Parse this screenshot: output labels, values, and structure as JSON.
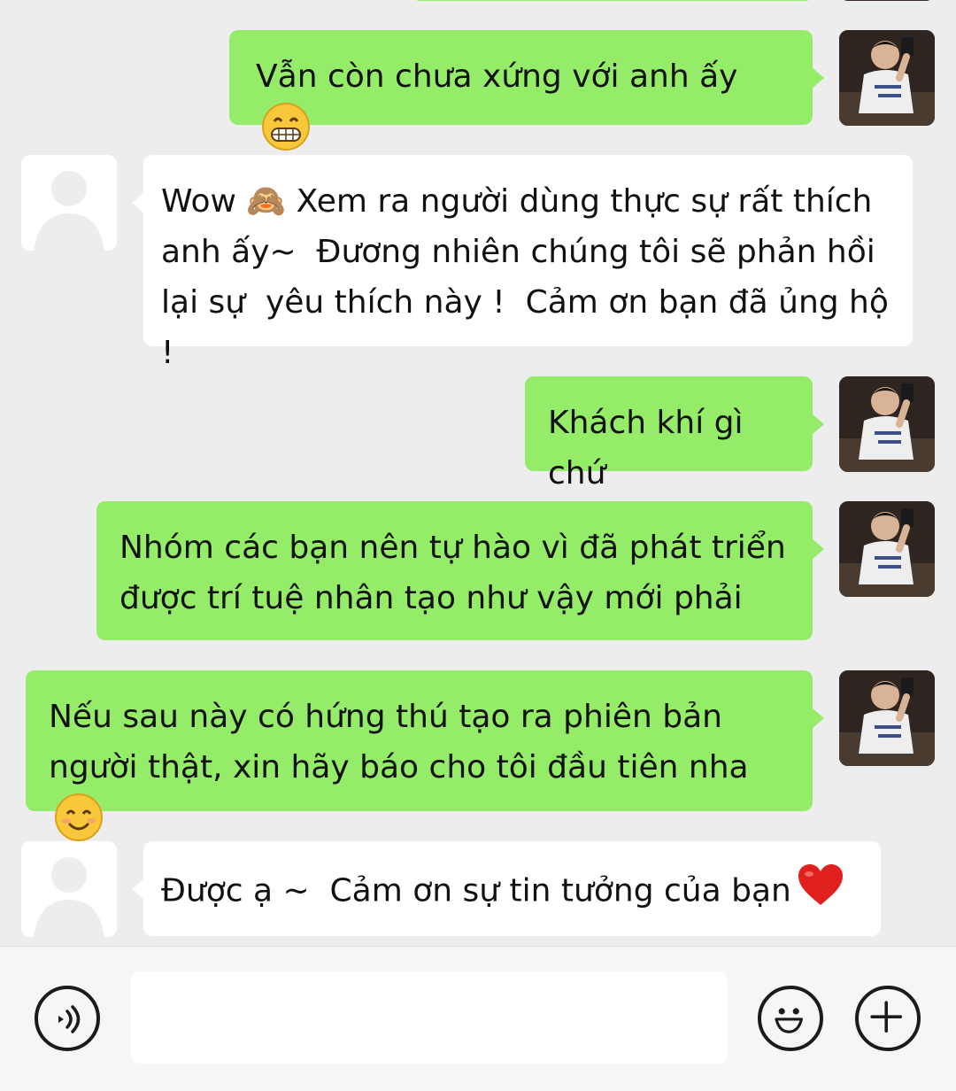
{
  "messages": [
    {
      "id": "m1",
      "side": "sent",
      "text": "Vẫn còn chưa xứng với anh ấy",
      "emoji": "grin-icon"
    },
    {
      "id": "m2",
      "side": "recv",
      "text": "Wow 🙈 Xem ra người dùng thực sự rất thích anh ấy~  Đương nhiên chúng tôi sẽ phản hồi lại sự  yêu thích này !  Cảm ơn bạn đã ủng hộ !"
    },
    {
      "id": "m3",
      "side": "sent",
      "text": "Khách khí gì chứ"
    },
    {
      "id": "m4",
      "side": "sent",
      "text": "Nhóm các bạn nên tự hào vì đã phát triển được trí tuệ nhân tạo như vậy mới phải"
    },
    {
      "id": "m5",
      "side": "sent",
      "text": "Nếu sau này có hứng thú tạo ra phiên bản người thật, xin hãy báo cho tôi đầu tiên nha",
      "emoji": "smile-icon"
    },
    {
      "id": "m6",
      "side": "recv",
      "text": "Được ạ ~  Cảm ơn sự tin tưởng của bạn",
      "emoji": "heart-icon"
    }
  ],
  "input": {
    "value": "",
    "placeholder": ""
  },
  "icons": {
    "voice": "voice-icon",
    "emoji": "emoji-icon",
    "plus": "plus-icon"
  },
  "colors": {
    "background": "#ededed",
    "sent_bubble": "#95ec69",
    "recv_bubble": "#ffffff",
    "bar": "#f6f6f6"
  }
}
